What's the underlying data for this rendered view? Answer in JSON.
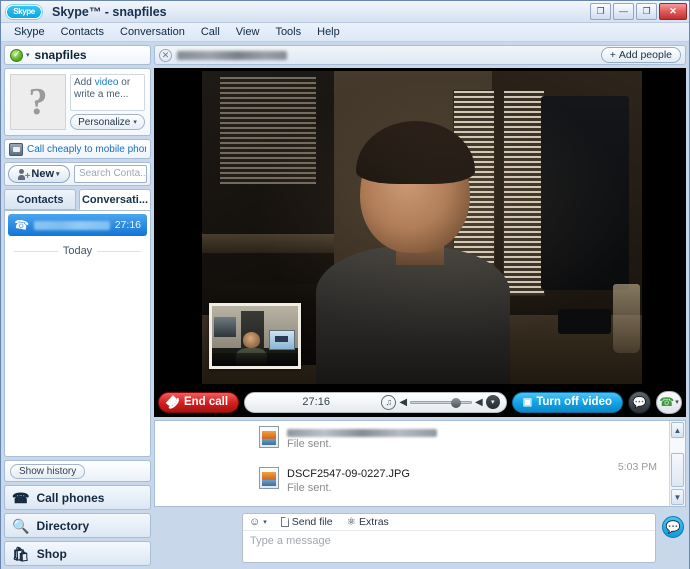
{
  "window": {
    "title": "Skype™ - snapfiles",
    "logo_text": "Skype",
    "controls": [
      {
        "name": "compact-view",
        "glyph": "❐"
      },
      {
        "name": "minimize",
        "glyph": "—"
      },
      {
        "name": "maximize",
        "glyph": "❐"
      },
      {
        "name": "close",
        "glyph": "✕"
      }
    ]
  },
  "menu": {
    "items": [
      {
        "label": "Skype",
        "accel": "S"
      },
      {
        "label": "Contacts",
        "accel": "C"
      },
      {
        "label": "Conversation",
        "accel": "o"
      },
      {
        "label": "Call",
        "accel": "a"
      },
      {
        "label": "View",
        "accel": "V"
      },
      {
        "label": "Tools",
        "accel": "T"
      },
      {
        "label": "Help",
        "accel": "H"
      }
    ]
  },
  "sidebar": {
    "status": {
      "icon": "online-check-icon",
      "username": "snapfiles",
      "caret": "▾"
    },
    "profile": {
      "avatar_glyph": "?",
      "mood_prefix": "Add ",
      "mood_link": "video",
      "mood_suffix": " or write a me...",
      "personalize_label": "Personalize",
      "personalize_caret": "▾"
    },
    "promo": {
      "icon": "phone-deal-icon",
      "link_text": "Call cheaply to mobile phon..."
    },
    "toolbar": {
      "new_label": "New",
      "new_caret": "▾",
      "search_placeholder": "Search Conta..."
    },
    "tabs": [
      {
        "label": "Contacts",
        "active": false
      },
      {
        "label": "Conversati...",
        "active": true
      }
    ],
    "conversation": {
      "call_icon": "phone-icon",
      "contact_name_redacted": true,
      "duration": "27:16",
      "divider_label": "Today"
    },
    "show_history_label": "Show history",
    "nav": [
      {
        "label": "Call phones",
        "icon": "telephone-icon",
        "glyph": "☎"
      },
      {
        "label": "Directory",
        "icon": "magnifier-icon",
        "glyph": "🔍"
      },
      {
        "label": "Shop",
        "icon": "shopping-bag-icon",
        "glyph": "🛍"
      }
    ]
  },
  "conversation_header": {
    "close_icon": "close-conversation-icon",
    "contact_name_redacted": true,
    "add_people_label": "Add people",
    "add_people_plus": "+"
  },
  "call_bar": {
    "end_call_label": "End call",
    "end_call_icon": "hangup-handset-icon",
    "timer": "27:16",
    "volume": {
      "speaker_icon": "speaker-settings-icon",
      "low_icon": "volume-low-icon",
      "high_icon": "volume-high-icon",
      "level_percent": 66,
      "caret": "▾"
    },
    "video_toggle_label": "Turn off video",
    "video_toggle_icon": "webcam-icon",
    "im_button_icon": "chat-bubble-icon",
    "call_button_icon": "phone-handset-icon",
    "call_button_caret": "▾"
  },
  "chat": {
    "messages": [
      {
        "icon": "jpg-file-icon",
        "title": "",
        "title_redacted": true,
        "status": "File sent.",
        "time": ""
      },
      {
        "icon": "jpg-file-icon",
        "title": "DSCF2547-09-0227.JPG",
        "title_redacted": false,
        "status": "File sent.",
        "time": "5:03 PM"
      }
    ],
    "scrollbar": {
      "up": "▲",
      "down": "▼"
    }
  },
  "composer": {
    "emoticon_icon": "smiley-icon",
    "emoticon_caret": "▾",
    "send_file_label": "Send file",
    "send_file_icon": "file-icon",
    "extras_label": "Extras",
    "extras_icon": "extras-icon",
    "message_placeholder": "Type a message",
    "send_button_icon": "send-chat-icon"
  },
  "colors": {
    "skype_blue": "#12a3e8",
    "end_call_red": "#d61f1f",
    "selected_row_blue": "#1175d6",
    "chrome_blue": "#c8d8ea",
    "online_green": "#4fa81d"
  }
}
